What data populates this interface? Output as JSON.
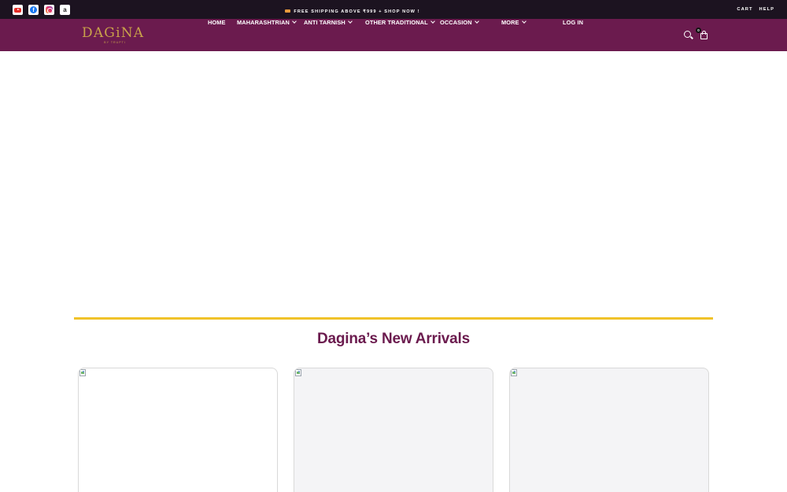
{
  "topbar": {
    "social": [
      {
        "name": "youtube-icon",
        "label": "YouTube"
      },
      {
        "name": "facebook-icon",
        "label": "f"
      },
      {
        "name": "instagram-icon",
        "label": "Instagram"
      },
      {
        "name": "amazon-icon",
        "label": "a"
      }
    ],
    "promo": "FREE SHIPPING ABOVE ₹999 + SHOP NOW !",
    "links": [
      "CART",
      "HELP"
    ]
  },
  "navbar": {
    "logo": {
      "word": "DAGiNA",
      "sub": "BY TRUPTI"
    },
    "items": [
      {
        "label": "HOME",
        "dropdown": false
      },
      {
        "label": "MAHARASHTRIAN",
        "dropdown": true
      },
      {
        "label": "ANTI TARNISH",
        "dropdown": true
      },
      {
        "label": "OTHER TRADITIONAL",
        "dropdown": true
      },
      {
        "label": "OCCASION",
        "dropdown": true
      },
      {
        "label": "MORE",
        "dropdown": true
      },
      {
        "label": "LOG IN",
        "dropdown": false
      }
    ],
    "cart_count": "0"
  },
  "main": {
    "section_title": "Dagina’s New Arrivals",
    "cards": [
      {
        "style": "white"
      },
      {
        "style": "grey"
      },
      {
        "style": "grey"
      }
    ]
  },
  "colors": {
    "topbar_bg": "#1c1320",
    "nav_bg": "#6b1b4e",
    "logo_gold": "#c9a24a",
    "accent_rule": "#f0c229",
    "title_color": "#6b1b4e"
  }
}
